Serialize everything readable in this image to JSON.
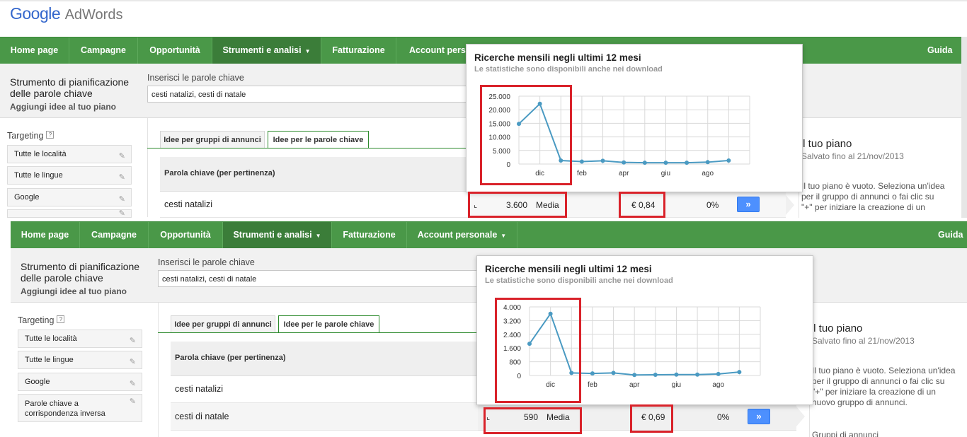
{
  "brand": {
    "google": "Google",
    "product": "AdWords"
  },
  "nav": {
    "items": [
      "Home page",
      "Campagne",
      "Opportunità",
      "Strumenti e analisi",
      "Fatturazione",
      "Account personale"
    ],
    "items_top_visible": [
      "Home page",
      "Campagne",
      "Opportunità",
      "Strumenti e analisi",
      "Fatturazione",
      "Account perso"
    ],
    "guida": "Guida"
  },
  "tool": {
    "title_line1": "Strumento di pianificazione",
    "title_line2": "delle parole chiave",
    "add_ideas": "Aggiungi idee al tuo piano",
    "keywords_label": "Inserisci le parole chiave",
    "keywords_value": "cesti natalizi, cesti di natale"
  },
  "targeting": {
    "label": "Targeting",
    "help": "?",
    "items": [
      "Tutte le località",
      "Tutte le lingue",
      "Google",
      "Parole chiave a corrispondenza inversa"
    ]
  },
  "tabs": {
    "ad_groups": "Idee per gruppi di annunci",
    "keywords": "Idee per le parole chiave"
  },
  "table": {
    "header_keyword": "Parola chiave (per pertinenza)",
    "rows": [
      "cesti natalizi",
      "cesti di natale"
    ]
  },
  "plan": {
    "title": "Il tuo piano",
    "saved": "Salvato fino al 21/nov/2013",
    "empty_lines": [
      "Il tuo piano è vuoto. Seleziona un'idea",
      "per il gruppo di annunci o fai clic su",
      "\"+\" per iniziare la creazione di un",
      "nuovo gruppo di annunci."
    ],
    "groups": "Gruppi di annunci"
  },
  "popup": {
    "title": "Ricerche mensili negli ultimi 12 mesi",
    "subtitle": "Le statistiche sono disponibili anche nei download"
  },
  "metrics": {
    "top": {
      "searches": "3.600",
      "label": "Media",
      "cpc": "€ 0,84",
      "competition": "0%"
    },
    "bottom": {
      "searches": "590",
      "label": "Media",
      "cpc": "€ 0,69",
      "competition": "0%"
    },
    "go": "»"
  },
  "colors": {
    "nav_green": "#4a9848",
    "nav_active": "#3b7d39",
    "line": "#4a9ac2",
    "highlight_red": "#d9222a",
    "button_blue": "#4d90fe"
  },
  "icons": {
    "chart": "line-chart-icon",
    "pencil": "pencil-icon",
    "caret": "caret-down-icon"
  },
  "chart_data": [
    {
      "type": "line",
      "title": "Ricerche mensili negli ultimi 12 mesi",
      "subtitle": "Le statistiche sono disponibili anche nei download",
      "x_ticks": [
        "dic",
        "feb",
        "apr",
        "giu",
        "ago"
      ],
      "y_ticks": [
        "0",
        "5.000",
        "10.000",
        "15.000",
        "20.000",
        "25.000"
      ],
      "ylim": [
        0,
        25000
      ],
      "grid": true,
      "series": [
        {
          "values": [
            14800,
            22200,
            1300,
            900,
            1200,
            600,
            500,
            500,
            500,
            700,
            1300
          ]
        }
      ]
    },
    {
      "type": "line",
      "title": "Ricerche mensili negli ultimi 12 mesi",
      "subtitle": "Le statistiche sono disponibili anche nei download",
      "x_ticks": [
        "dic",
        "feb",
        "apr",
        "giu",
        "ago"
      ],
      "y_ticks": [
        "0",
        "800",
        "1.600",
        "2.400",
        "3.200",
        "4.000"
      ],
      "ylim": [
        0,
        4000
      ],
      "grid": true,
      "series": [
        {
          "values": [
            1850,
            3600,
            150,
            120,
            150,
            30,
            40,
            50,
            50,
            90,
            200
          ]
        }
      ]
    }
  ]
}
